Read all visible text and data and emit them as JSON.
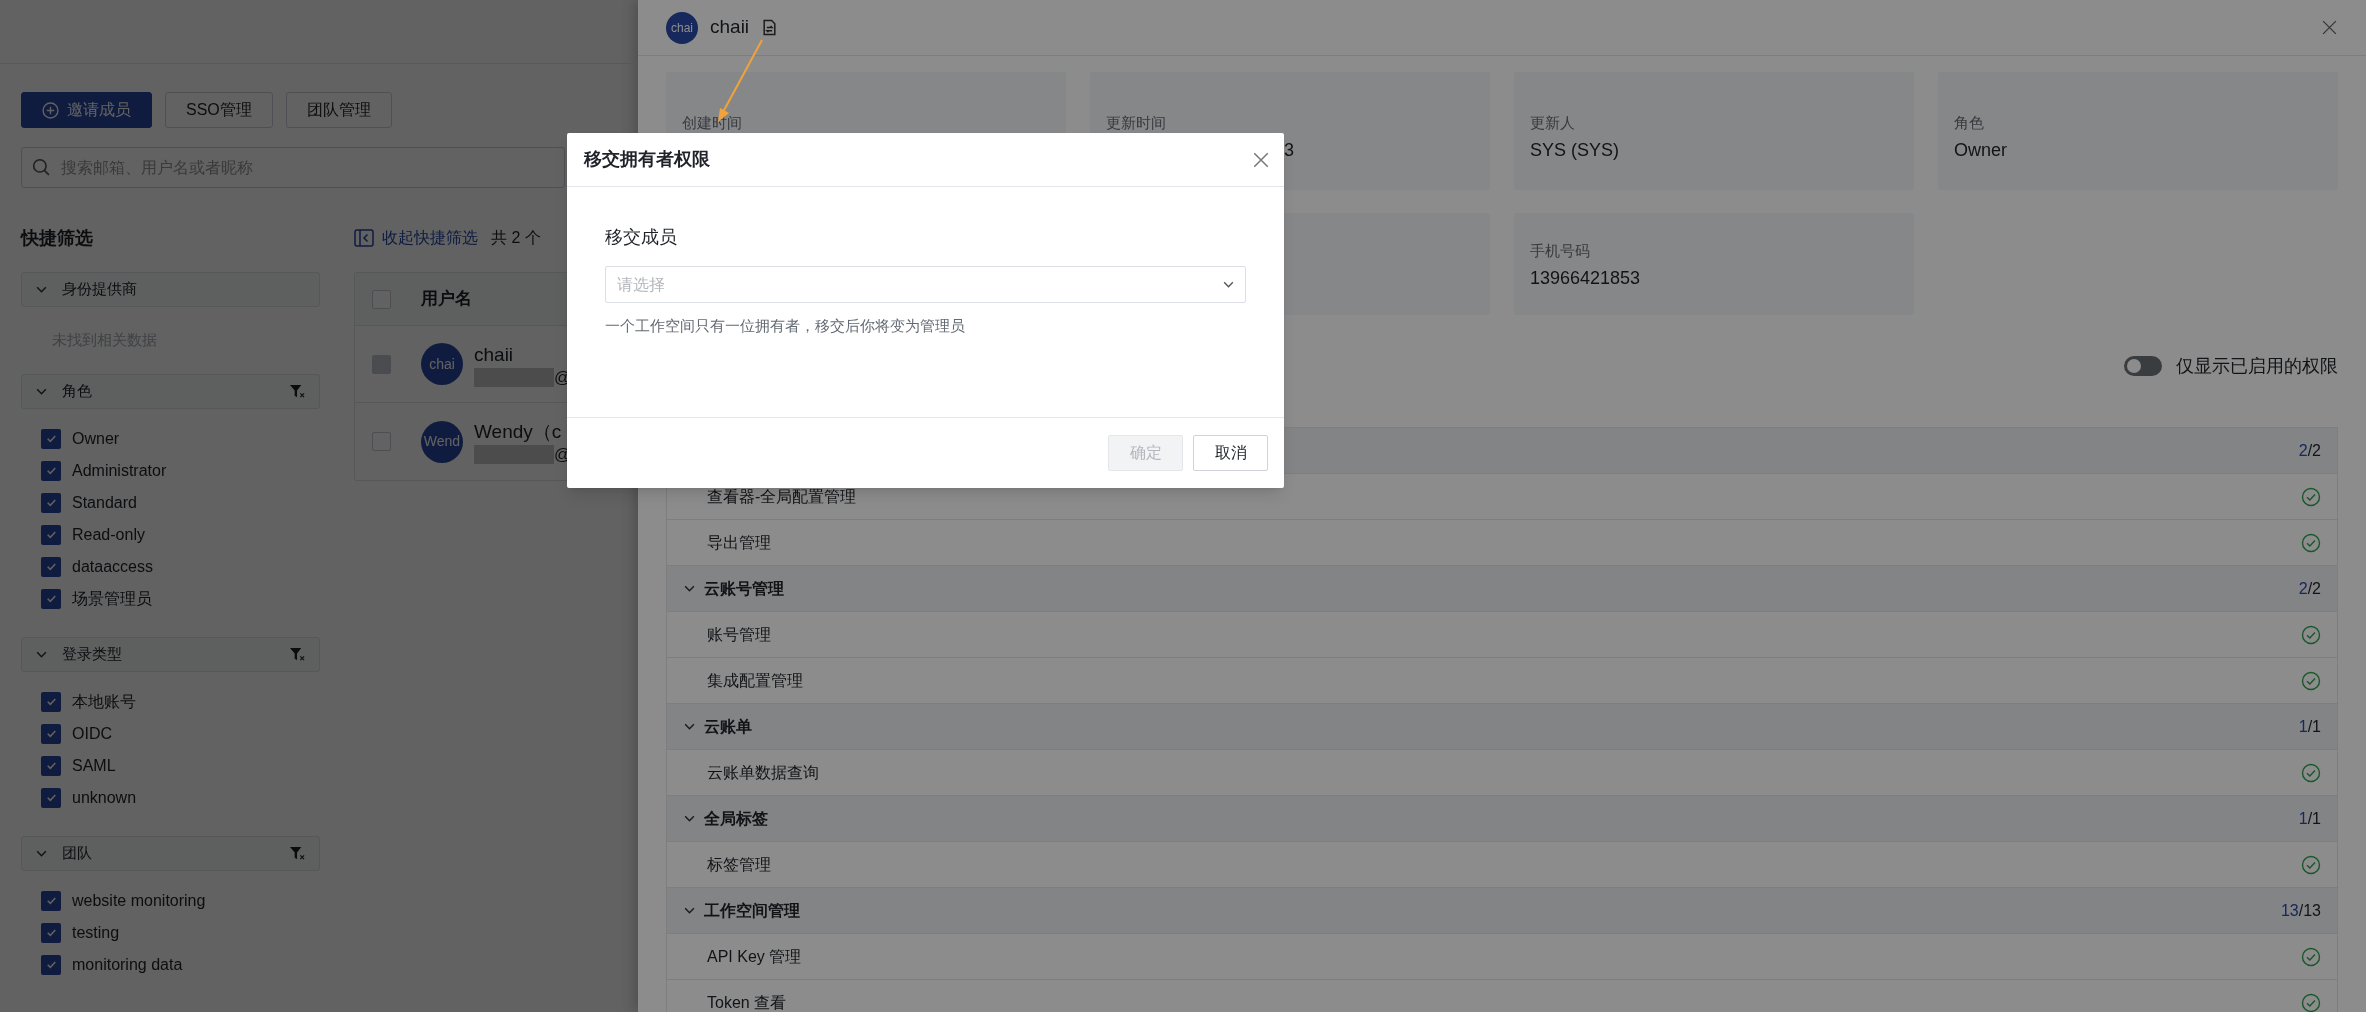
{
  "page": {
    "buttons": [
      {
        "label": "邀请成员",
        "kind": "primary"
      },
      {
        "label": "SSO管理",
        "kind": "default"
      },
      {
        "label": "团队管理",
        "kind": "default"
      }
    ],
    "search": {
      "placeholder": "搜索邮箱、用户名或者昵称"
    },
    "filter_title": "快捷筛选",
    "collapse_link": "收起快捷筛选",
    "count": "共 2 个",
    "filter_groups": [
      {
        "title": "身份提供商",
        "expanded": true,
        "clearable": false,
        "empty_text": "未找到相关数据"
      },
      {
        "title": "角色",
        "expanded": true,
        "clearable": true,
        "options": [
          {
            "label": "Owner",
            "checked": true
          },
          {
            "label": "Administrator",
            "checked": true
          },
          {
            "label": "Standard",
            "checked": true
          },
          {
            "label": "Read-only",
            "checked": true
          },
          {
            "label": "dataaccess",
            "checked": true
          },
          {
            "label": "场景管理员",
            "checked": true
          }
        ]
      },
      {
        "title": "登录类型",
        "expanded": true,
        "clearable": true,
        "options": [
          {
            "label": "本地账号",
            "checked": true
          },
          {
            "label": "OIDC",
            "checked": true
          },
          {
            "label": "SAML",
            "checked": true
          },
          {
            "label": "unknown",
            "checked": true
          }
        ]
      },
      {
        "title": "团队",
        "expanded": true,
        "clearable": true,
        "options": [
          {
            "label": "website monitoring",
            "checked": true
          },
          {
            "label": "testing",
            "checked": true
          },
          {
            "label": "monitoring data",
            "checked": true
          }
        ]
      }
    ],
    "table": {
      "select_all": {
        "checked": false
      },
      "columns": [
        "用户名"
      ],
      "rows": [
        {
          "avatar": "chai",
          "name": "chaii",
          "email": "@",
          "disabled": true
        },
        {
          "avatar": "Wend",
          "name": "Wendy（c",
          "email": "@",
          "disabled": false
        }
      ]
    }
  },
  "drawer": {
    "user": {
      "avatar": "chai",
      "name": "chaii"
    },
    "info": [
      {
        "label": "创建时间"
      },
      {
        "label": "更新时间",
        "value": "3"
      },
      {
        "label": "更新人",
        "value": "SYS (SYS)"
      },
      {
        "label": "角色",
        "value": "Owner"
      },
      {
        "label": "手机号码",
        "value": "13966421853"
      }
    ],
    "toggle": {
      "label": "仅显示已启用的权限",
      "on": false
    },
    "permissions": [
      {
        "granted": "2",
        "of": "/2",
        "expanded": true,
        "items": [
          {
            "label": "查看器-全局配置管理",
            "enabled": true
          },
          {
            "label": "导出管理",
            "enabled": true
          }
        ]
      },
      {
        "title": "云账号管理",
        "granted": "2",
        "of": "/2",
        "expanded": true,
        "items": [
          {
            "label": "账号管理",
            "enabled": true
          },
          {
            "label": "集成配置管理",
            "enabled": true
          }
        ]
      },
      {
        "title": "云账单",
        "granted": "1",
        "of": "/1",
        "expanded": true,
        "items": [
          {
            "label": "云账单数据查询",
            "enabled": true
          }
        ]
      },
      {
        "title": "全局标签",
        "granted": "1",
        "of": "/1",
        "expanded": true,
        "items": [
          {
            "label": "标签管理",
            "enabled": true
          }
        ]
      },
      {
        "title": "工作空间管理",
        "granted": "13",
        "of": "/13",
        "expanded": true,
        "items": [
          {
            "label": "API Key 管理",
            "enabled": true
          },
          {
            "label": "Token 查看",
            "enabled": true
          }
        ]
      }
    ]
  },
  "modal": {
    "title": "移交拥有者权限",
    "field_label": "移交成员",
    "select": {
      "placeholder": "请选择"
    },
    "hint": "一个工作空间只有一位拥有者，移交后你将变为管理员",
    "buttons": [
      {
        "label": "确定",
        "disabled": true
      },
      {
        "label": "取消",
        "disabled": false
      }
    ]
  }
}
